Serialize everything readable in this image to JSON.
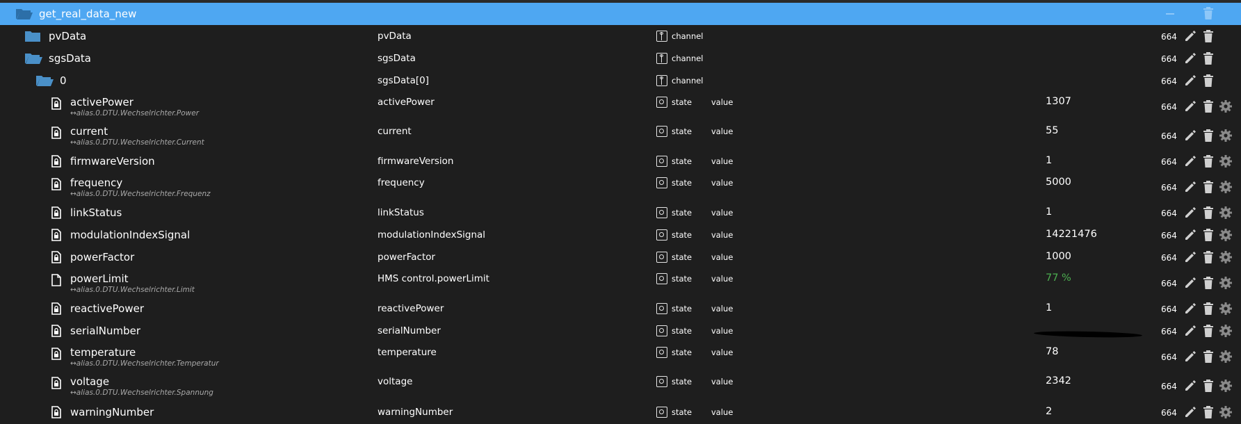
{
  "header": {
    "title": "get_real_data_new"
  },
  "acl_default": "664",
  "rows": [
    {
      "name": "pvData",
      "col_name": "pvData",
      "type": "channel",
      "role": "",
      "value": "",
      "alias": "",
      "icon": "folder-closed-icon"
    },
    {
      "name": "sgsData",
      "col_name": "sgsData",
      "type": "channel",
      "role": "",
      "value": "",
      "alias": "",
      "icon": "folder-open-icon"
    },
    {
      "name": "0",
      "col_name": "sgsData[0]",
      "type": "channel",
      "role": "",
      "value": "",
      "alias": "",
      "icon": "folder-open-icon"
    },
    {
      "name": "activePower",
      "col_name": "activePower",
      "type": "state",
      "role": "value",
      "value": "1307",
      "alias": "↔alias.0.DTU.Wechselrichter.Power",
      "icon": "file-lock-icon"
    },
    {
      "name": "current",
      "col_name": "current",
      "type": "state",
      "role": "value",
      "value": "55",
      "alias": "↔alias.0.DTU.Wechselrichter.Current",
      "icon": "file-lock-icon"
    },
    {
      "name": "firmwareVersion",
      "col_name": "firmwareVersion",
      "type": "state",
      "role": "value",
      "value": "1",
      "alias": "",
      "icon": "file-lock-icon"
    },
    {
      "name": "frequency",
      "col_name": "frequency",
      "type": "state",
      "role": "value",
      "value": "5000",
      "alias": "↔alias.0.DTU.Wechselrichter.Frequenz",
      "icon": "file-lock-icon"
    },
    {
      "name": "linkStatus",
      "col_name": "linkStatus",
      "type": "state",
      "role": "value",
      "value": "1",
      "alias": "",
      "icon": "file-lock-icon"
    },
    {
      "name": "modulationIndexSignal",
      "col_name": "modulationIndexSignal",
      "type": "state",
      "role": "value",
      "value": "14221476",
      "alias": "",
      "icon": "file-lock-icon"
    },
    {
      "name": "powerFactor",
      "col_name": "powerFactor",
      "type": "state",
      "role": "value",
      "value": "1000",
      "alias": "",
      "icon": "file-lock-icon"
    },
    {
      "name": "powerLimit",
      "col_name": "HMS control.powerLimit",
      "type": "state",
      "role": "value",
      "value": "77 %",
      "value_color": "#4caf50",
      "alias": "↔alias.0.DTU.Wechselrichter.Limit",
      "icon": "file-icon"
    },
    {
      "name": "reactivePower",
      "col_name": "reactivePower",
      "type": "state",
      "role": "value",
      "value": "1",
      "alias": "",
      "icon": "file-lock-icon"
    },
    {
      "name": "serialNumber",
      "col_name": "serialNumber",
      "type": "state",
      "role": "value",
      "value": "",
      "alias": "",
      "icon": "file-lock-icon"
    },
    {
      "name": "temperature",
      "col_name": "temperature",
      "type": "state",
      "role": "value",
      "value": "78",
      "alias": "↔alias.0.DTU.Wechselrichter.Temperatur",
      "icon": "file-lock-icon"
    },
    {
      "name": "voltage",
      "col_name": "voltage",
      "type": "state",
      "role": "value",
      "value": "2342",
      "alias": "↔alias.0.DTU.Wechselrichter.Spannung",
      "icon": "file-lock-icon"
    },
    {
      "name": "warningNumber",
      "col_name": "warningNumber",
      "type": "state",
      "role": "value",
      "value": "2",
      "alias": "",
      "icon": "file-lock-icon"
    }
  ],
  "colors": {
    "header_bg": "#4ea7f2",
    "folder": "#4a90c8",
    "bg": "#1e1e1e",
    "value_green": "#4caf50"
  }
}
